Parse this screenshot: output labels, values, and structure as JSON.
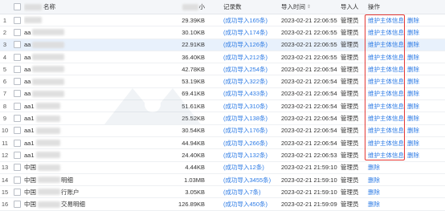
{
  "header": {
    "name_label": "名称",
    "size_label": "小",
    "records_label": "记录数",
    "time_label": "导入时间",
    "time_sort_icon": "sort-icon",
    "importer_label": "导入人",
    "ops_label": "操作"
  },
  "actions": {
    "maintain": "维护主体信息",
    "delete": "删除"
  },
  "rows": [
    {
      "idx": "1",
      "name": "",
      "size": "29.39KB",
      "records": "(成功导入165条)",
      "time": "2023-02-21 22:06:55",
      "importer": "管理员",
      "maintain": true
    },
    {
      "idx": "2",
      "name": "aa",
      "size": "30.10KB",
      "records": "(成功导入174条)",
      "time": "2023-02-21 22:06:55",
      "importer": "管理员",
      "maintain": true
    },
    {
      "idx": "3",
      "name": "aa",
      "size": "22.91KB",
      "records": "(成功导入126条)",
      "time": "2023-02-21 22:06:55",
      "importer": "管理员",
      "maintain": true,
      "selected": true
    },
    {
      "idx": "4",
      "name": "aa",
      "size": "36.40KB",
      "records": "(成功导入212条)",
      "time": "2023-02-21 22:06:55",
      "importer": "管理员",
      "maintain": true
    },
    {
      "idx": "5",
      "name": "aa",
      "size": "42.78KB",
      "records": "(成功导入254条)",
      "time": "2023-02-21 22:06:54",
      "importer": "管理员",
      "maintain": true
    },
    {
      "idx": "6",
      "name": "aa",
      "size": "53.19KB",
      "records": "(成功导入322条)",
      "time": "2023-02-21 22:06:54",
      "importer": "管理员",
      "maintain": true
    },
    {
      "idx": "7",
      "name": "aa",
      "size": "69.41KB",
      "records": "(成功导入433条)",
      "time": "2023-02-21 22:06:54",
      "importer": "管理员",
      "maintain": true
    },
    {
      "idx": "8",
      "name": "aa1",
      "size": "51.61KB",
      "records": "(成功导入310条)",
      "time": "2023-02-21 22:06:54",
      "importer": "管理员",
      "maintain": true
    },
    {
      "idx": "9",
      "name": "aa1",
      "size": "25.52KB",
      "records": "(成功导入138条)",
      "time": "2023-02-21 22:06:54",
      "importer": "管理员",
      "maintain": true
    },
    {
      "idx": "10",
      "name": "aa1",
      "size": "30.54KB",
      "records": "(成功导入176条)",
      "time": "2023-02-21 22:06:54",
      "importer": "管理员",
      "maintain": true
    },
    {
      "idx": "11",
      "name": "aa1",
      "size": "44.94KB",
      "records": "(成功导入266条)",
      "time": "2023-02-21 22:06:54",
      "importer": "管理员",
      "maintain": true
    },
    {
      "idx": "12",
      "name": "aa1",
      "size": "24.40KB",
      "records": "(成功导入132条)",
      "time": "2023-02-21 22:06:53",
      "importer": "管理员",
      "maintain": true
    },
    {
      "idx": "13",
      "name": "中国",
      "size": "4.44KB",
      "records": "(成功导入12条)",
      "time": "2023-02-21 21:59:10",
      "importer": "管理员",
      "maintain": false
    },
    {
      "idx": "14",
      "name": "中国",
      "name_suffix": "明细",
      "size": "1.03MB",
      "records": "(成功导入3455条)",
      "time": "2023-02-21 21:59:10",
      "importer": "管理员",
      "maintain": false
    },
    {
      "idx": "15",
      "name": "中国",
      "name_suffix": "行账户",
      "size": "3.05KB",
      "records": "(成功导入7条)",
      "time": "2023-02-21 21:59:10",
      "importer": "管理员",
      "maintain": false
    },
    {
      "idx": "16",
      "name": "中国",
      "name_suffix": "交易明细",
      "size": "126.89KB",
      "records": "(成功导入450条)",
      "time": "2023-02-21 21:59:09",
      "importer": "管理员",
      "maintain": false
    }
  ],
  "colors": {
    "link": "#2d7be5",
    "highlight": "#e53935",
    "selected_row": "#e8f1fc"
  }
}
